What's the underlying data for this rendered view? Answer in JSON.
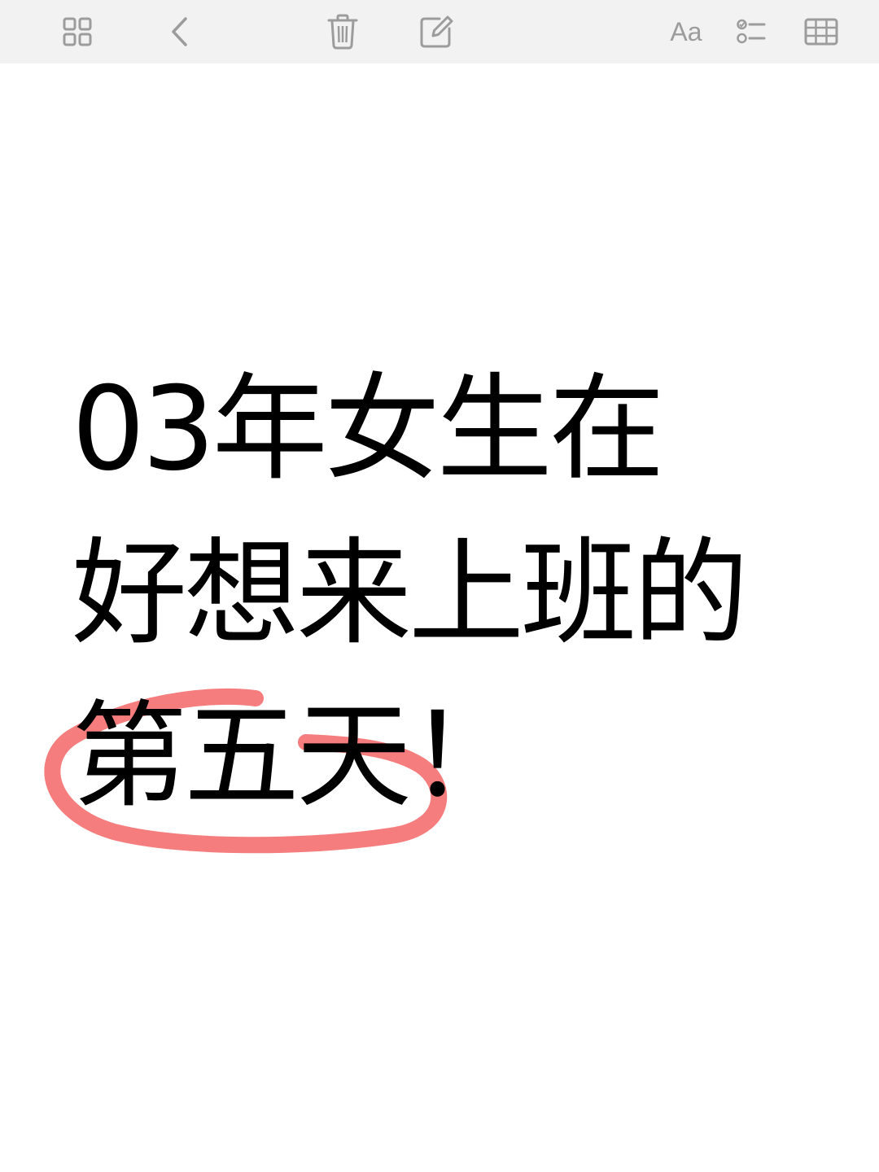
{
  "toolbar": {
    "font_label": "Aa",
    "icons": [
      "grid-view-icon",
      "back-chevron-icon",
      "trash-icon",
      "compose-icon",
      "checklist-icon",
      "table-icon"
    ],
    "icon_color": "#9c9c9c",
    "background": "#f2f2f2"
  },
  "note": {
    "line1": "03年女生在",
    "line2": "好想来上班的",
    "line3_highlight": "第五天",
    "line3_rest": "！",
    "highlight_color": "#f47676"
  }
}
